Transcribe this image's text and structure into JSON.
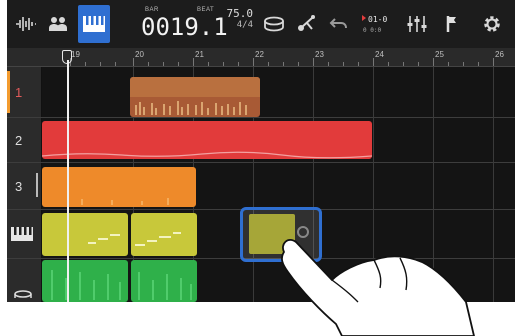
{
  "toolbar": {
    "buttons": [
      {
        "icon": "waveform-icon"
      },
      {
        "icon": "mixer-people-icon"
      },
      {
        "icon": "piano-keyboard-icon",
        "active": true
      },
      {
        "icon": "drum-icon"
      },
      {
        "icon": "metronome-icon"
      },
      {
        "icon": "undo-icon"
      },
      {
        "icon": "marker-icon"
      },
      {
        "icon": "faders-icon"
      },
      {
        "icon": "flag-icon"
      },
      {
        "icon": "gear-icon"
      }
    ],
    "counter": {
      "bar_label": "BAR",
      "beat_label": "BEAT",
      "value": "0019.1"
    },
    "tempo": {
      "bpm": "75.0",
      "signature": "4/4"
    },
    "marker_text": {
      "top": "01-0",
      "bottom": "0 0:0"
    }
  },
  "ruler": {
    "bars": [
      "19",
      "20",
      "21",
      "22",
      "23",
      "24",
      "25",
      "26"
    ]
  },
  "tracks": [
    {
      "label": "1",
      "color": "#f39b2e"
    },
    {
      "label": "2",
      "color": "#e23b3b"
    },
    {
      "label": "3",
      "color": "#f39b2e"
    },
    {
      "label": "",
      "icon": "piano-keyboard-icon",
      "color": "#c8c83a"
    },
    {
      "label": "",
      "icon": "drum-icon",
      "color": "#2fb04a"
    }
  ],
  "colors": {
    "accent_blue": "#2f6fd1",
    "track_orange": "#f39b2e",
    "track_red": "#e23b3b",
    "track_yellow": "#c8c83a",
    "track_green": "#2fb04a"
  }
}
